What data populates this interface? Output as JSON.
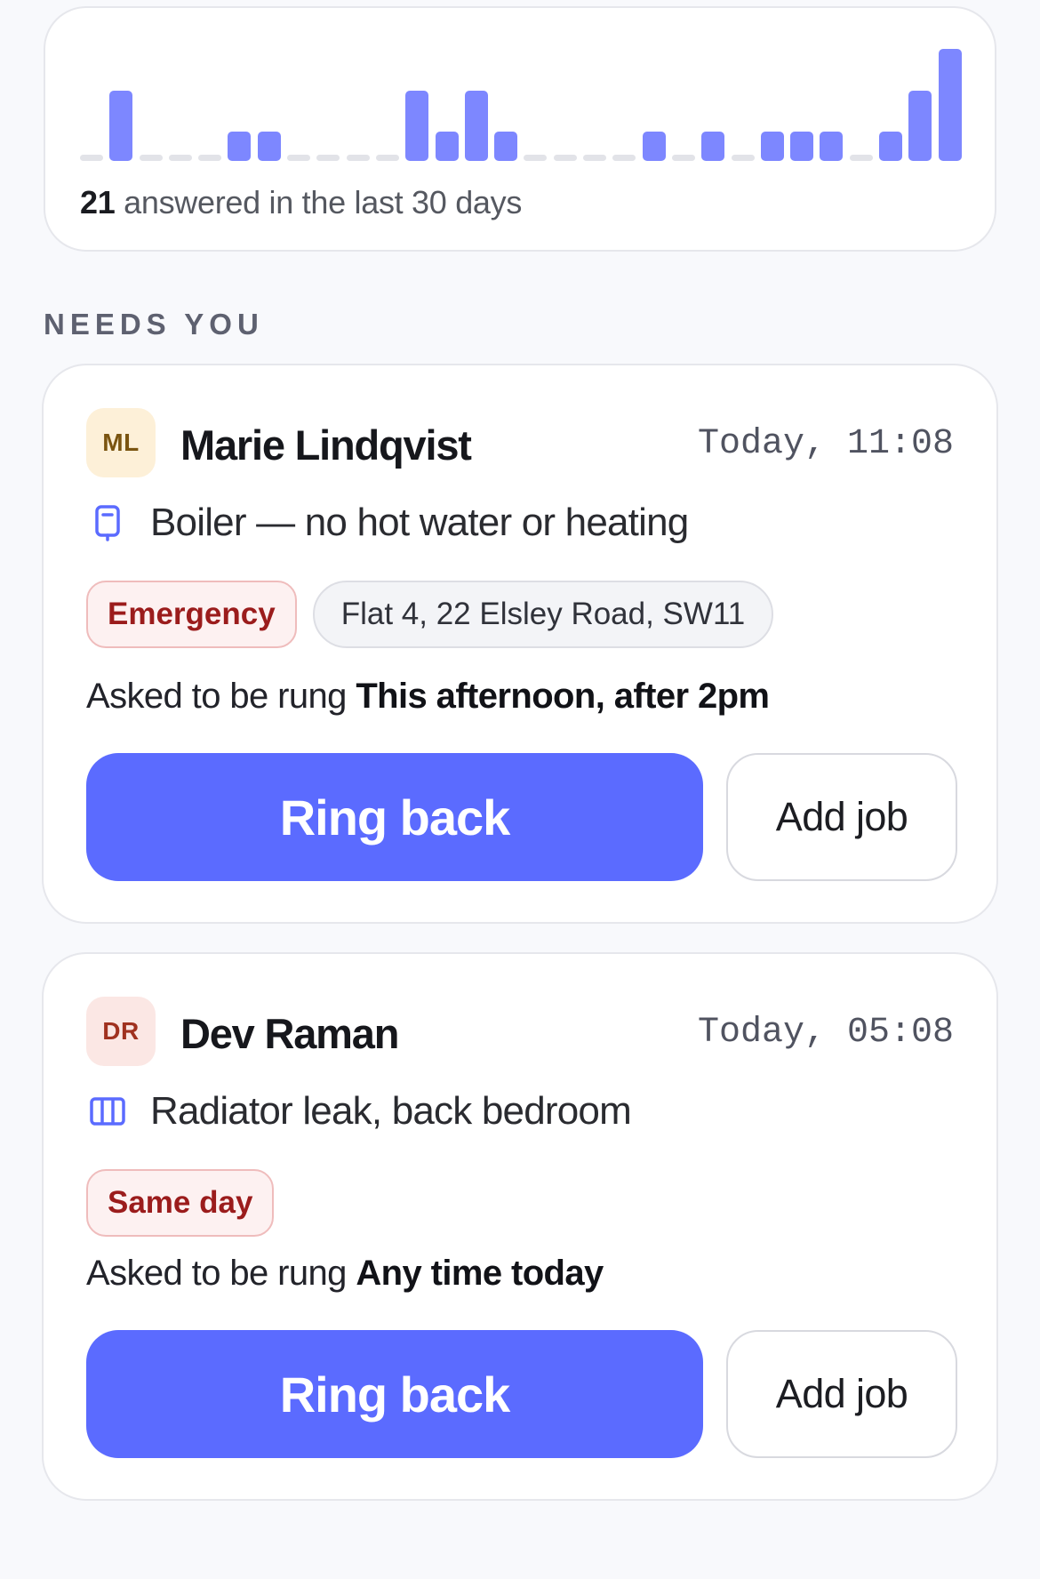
{
  "activity": {
    "count": "21",
    "caption": " answered in the last 30 days",
    "daily_counts": [
      0,
      2,
      0,
      0,
      0,
      1,
      1,
      0,
      0,
      0,
      0,
      2,
      1,
      2,
      1,
      0,
      0,
      0,
      0,
      1,
      0,
      1,
      0,
      1,
      1,
      1,
      0,
      1,
      2,
      3
    ]
  },
  "needs_you": {
    "heading": "NEEDS YOU",
    "requests": [
      {
        "initials": "ML",
        "name": "Marie Lindqvist",
        "time": "Today, 11:08",
        "issue_icon": "boiler-icon",
        "issue": "Boiler — no hot water or heating",
        "urgency": "Emergency",
        "address": "Flat 4, 22 Elsley Road, SW11",
        "ring_prefix": "Asked to be rung ",
        "ring_window": "This afternoon, after 2pm",
        "primary_action": "Ring back",
        "secondary_action": "Add job"
      },
      {
        "initials": "DR",
        "name": "Dev Raman",
        "time": "Today, 05:08",
        "issue_icon": "radiator-icon",
        "issue": "Radiator leak, back bedroom",
        "urgency": "Same day",
        "ring_prefix": "Asked to be rung ",
        "ring_window": "Any time today",
        "primary_action": "Ring back",
        "secondary_action": "Add job"
      }
    ]
  },
  "colors": {
    "accent": "#5b6bff",
    "bar": "#7d87ff",
    "bar_empty": "#e2e3e8",
    "urgent_text": "#9b1c1c",
    "avatar_ml_bg": "#fdf0d8",
    "avatar_ml_text": "#7a5410",
    "avatar_dr_bg": "#fbe7e4",
    "avatar_dr_text": "#a0311f"
  }
}
